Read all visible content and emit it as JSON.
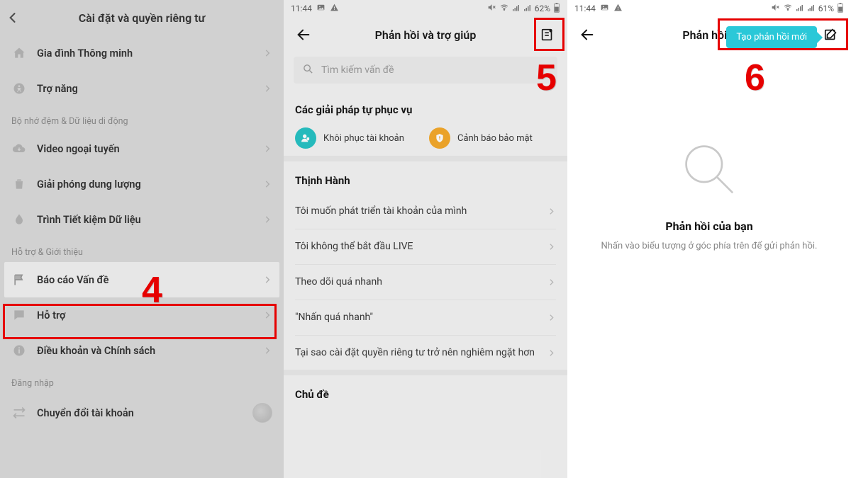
{
  "panel1": {
    "title": "Cài đặt và quyền riêng tư",
    "rows1": [
      {
        "icon": "home-icon",
        "label": "Gia đình Thông minh"
      },
      {
        "icon": "accessibility-icon",
        "label": "Trợ năng"
      }
    ],
    "section_cache": "Bộ nhớ đệm & Dữ liệu di động",
    "rows2": [
      {
        "icon": "cloud-down-icon",
        "label": "Video ngoại tuyến"
      },
      {
        "icon": "trash-icon",
        "label": "Giải phóng dung lượng"
      },
      {
        "icon": "drop-icon",
        "label": "Trình Tiết kiệm Dữ liệu"
      }
    ],
    "section_support": "Hỗ trợ & Giới thiệu",
    "rows3": [
      {
        "icon": "flag-icon",
        "label": "Báo cáo Vấn đề"
      },
      {
        "icon": "chat-icon",
        "label": "Hỗ trợ"
      },
      {
        "icon": "info-icon",
        "label": "Điều khoản và Chính sách"
      }
    ],
    "section_login": "Đăng nhập",
    "switch_account": "Chuyển đổi tài khoản",
    "step": "4"
  },
  "panel2": {
    "status_time": "11:44",
    "battery": "62%",
    "title": "Phản hồi và trợ giúp",
    "search_placeholder": "Tìm kiếm vấn đề",
    "self_h": "Các giải pháp tự phục vụ",
    "self": [
      {
        "label": "Khôi phục tài khoản"
      },
      {
        "label": "Cảnh báo bảo mật"
      }
    ],
    "trending_h": "Thịnh Hành",
    "trending": [
      "Tôi muốn phát triển tài khoản của mình",
      "Tôi không thể bắt đầu LIVE",
      "Theo dõi quá nhanh",
      "\"Nhấn quá nhanh\"",
      "Tại sao cài đặt quyền riêng tư trở nên nghiêm ngặt hơn"
    ],
    "topic_h": "Chủ đề",
    "step": "5"
  },
  "panel3": {
    "status_time": "11:44",
    "battery": "61%",
    "title_partial": "Phản hồi c",
    "tooltip": "Tạo phản hồi mới",
    "empty_h": "Phản hồi của bạn",
    "empty_p": "Nhấn vào biểu tượng ở góc phía trên để gửi phản hồi.",
    "step": "6"
  }
}
